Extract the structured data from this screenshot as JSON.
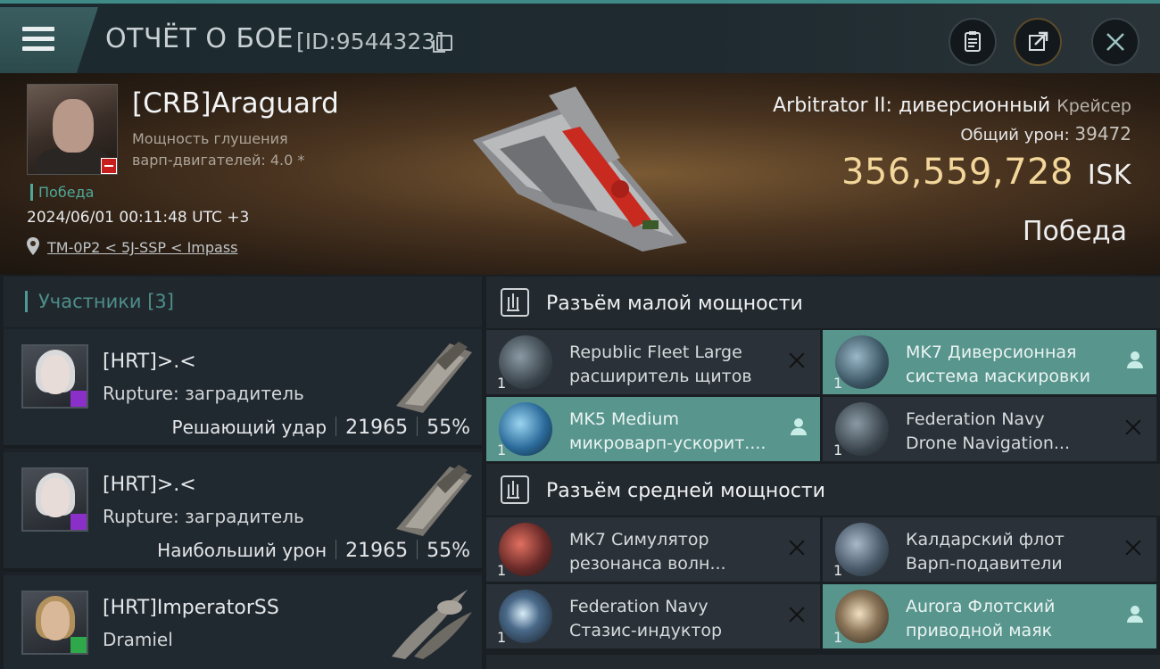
{
  "header": {
    "title": "ОТЧЁТ О БОЕ",
    "id_text": "[ID:9544323]",
    "menu_icon": "hamburger-icon",
    "buttons": [
      "clipboard-icon",
      "share-icon",
      "close-icon"
    ]
  },
  "victim": {
    "name": "[CRB]Araguard",
    "subtitle_line1": "Мощность глушения",
    "subtitle_line2": "варп-двигателей: 4.0 *",
    "status": "Победа",
    "datetime": "2024/06/01 00:11:48 UTC +3",
    "location": "TM-0P2 < 5J-SSP < Impass",
    "ship_name": "Arbitrator II: диверсионный",
    "ship_class": "Крейсер",
    "total_damage_label": "Общий урон:",
    "total_damage": "39472",
    "isk_value": "356,559,728",
    "isk_unit": "ISK",
    "result": "Победа"
  },
  "participants": {
    "title": "Участники [3]",
    "rows": [
      {
        "name": "[HRT]>.<",
        "ship": "Rupture: заградитель",
        "label": "Решающий удар",
        "damage": "21965",
        "percent": "55%"
      },
      {
        "name": "[HRT]>.<",
        "ship": "Rupture: заградитель",
        "label": "Наибольший урон",
        "damage": "21965",
        "percent": "55%"
      },
      {
        "name": "[HRT]ImperatorSS",
        "ship": "Dramiel"
      }
    ]
  },
  "slots": {
    "low": {
      "title": "Разъём малой мощности",
      "items": [
        {
          "line1": "Republic Fleet Large",
          "line2": "расширитель щитов",
          "qty": "1"
        },
        {
          "line1": "MK7 Диверсионная",
          "line2": "система маскировки",
          "qty": "1"
        },
        {
          "line1": "MK5 Medium",
          "line2": "микроварп-ускорит....",
          "qty": "1"
        },
        {
          "line1": "Federation Navy",
          "line2": "Drone Navigation...",
          "qty": "1"
        }
      ]
    },
    "mid": {
      "title": "Разъём средней мощности",
      "items": [
        {
          "line1": "MK7 Симулятор",
          "line2": "резонанса волн...",
          "qty": "1"
        },
        {
          "line1": "Калдарский флот",
          "line2": "Варп-подавители",
          "qty": "1"
        },
        {
          "line1": "Federation Navy",
          "line2": "Стазис-индуктор",
          "qty": "1"
        },
        {
          "line1": "Aurora Флотский",
          "line2": "приводной маяк",
          "qty": "1"
        }
      ]
    }
  }
}
